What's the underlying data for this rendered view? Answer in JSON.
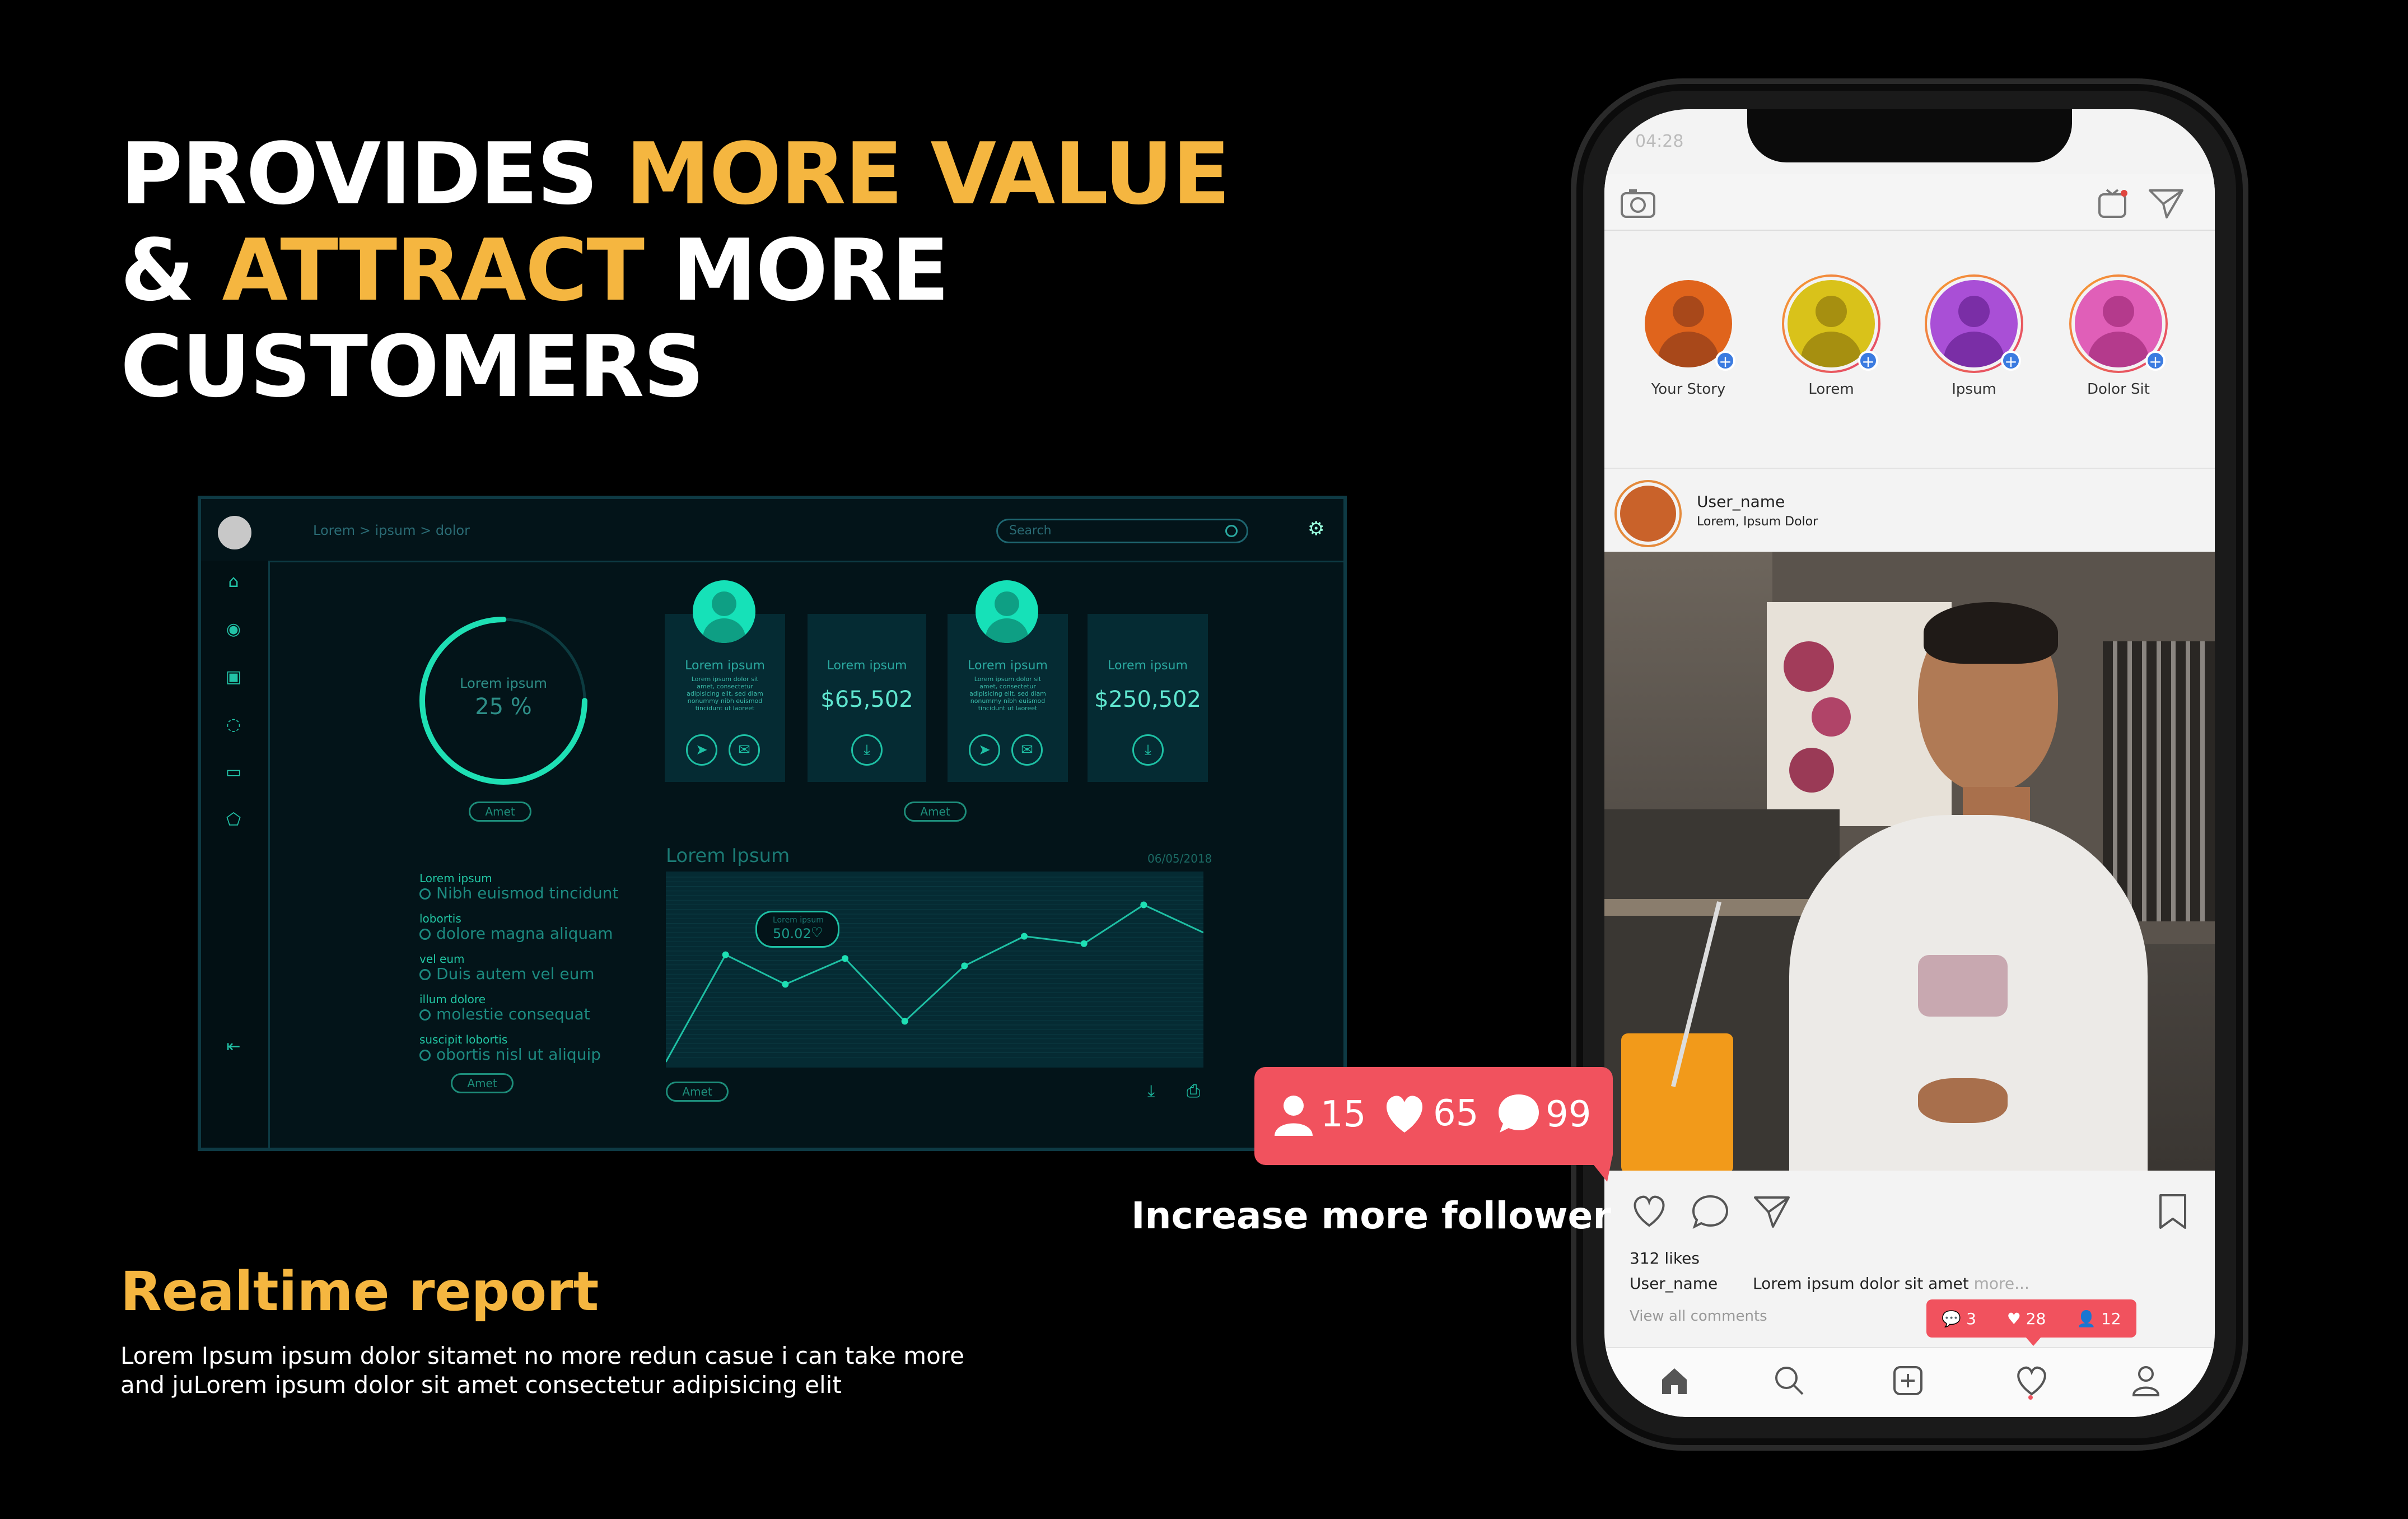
{
  "headline": {
    "line1_a": "PROVIDES ",
    "line1_b": "MORE VALUE",
    "line2_a": "& ",
    "line2_b": "ATTRACT",
    "line2_c": " MORE",
    "line3": "CUSTOMERS"
  },
  "dashboard": {
    "breadcrumb": "Lorem  >  ipsum  >  dolor",
    "search_placeholder": "Search",
    "ring": {
      "label": "Lorem ipsum",
      "value_text": "25 %",
      "percent": 25
    },
    "ring_button": "Amet",
    "cards": [
      {
        "label": "Lorem ipsum",
        "text": "Lorem ipsum dolor sit amet, consectetur adipisicing elit, sed diam nonummy nibh euismod tincidunt ut laoreet"
      },
      {
        "label": "Lorem ipsum",
        "value": "$65,502"
      },
      {
        "label": "Lorem ipsum",
        "text": "Lorem ipsum dolor sit amet, consectetur adipisicing elit, sed diam nonummy nibh euismod tincidunt ut laoreet"
      },
      {
        "label": "Lorem ipsum",
        "value": "$250,502"
      }
    ],
    "cards_button": "Amet",
    "list": [
      {
        "key": "Lorem ipsum",
        "value": "Nibh euismod tincidunt"
      },
      {
        "key": "lobortis",
        "value": "dolore magna aliquam"
      },
      {
        "key": "vel eum",
        "value": "Duis autem vel eum"
      },
      {
        "key": "illum dolore",
        "value": "molestie consequat"
      },
      {
        "key": "suscipit lobortis",
        "value": "obortis nisl ut aliquip"
      }
    ],
    "list_button": "Amet",
    "chart_title": "Lorem Ipsum",
    "chart_date": "06/05/2018",
    "chart_button": "Amet",
    "tooltip_title": "Lorem ipsum",
    "tooltip_value": "50.02"
  },
  "chart_data": {
    "type": "line",
    "title": "Lorem Ipsum",
    "x": [
      0,
      1,
      2,
      3,
      4,
      5,
      6,
      7,
      8,
      9
    ],
    "values": [
      0,
      58,
      42,
      56,
      22,
      52,
      68,
      64,
      85,
      70
    ],
    "ylim": [
      0,
      100
    ],
    "grid": true
  },
  "report": {
    "title": "Realtime report",
    "body_line1": "Lorem Ipsum ipsum dolor sitamet no more redun casue i can take more",
    "body_line2": "and juLorem ipsum dolor sit amet consectetur adipisicing elit"
  },
  "notification": {
    "followers": "15",
    "likes": "65",
    "comments": "99",
    "caption": "Increase more follower"
  },
  "phone": {
    "time": "04:28",
    "stories": [
      {
        "name": "Your Story",
        "color": "#e0641c"
      },
      {
        "name": "Lorem",
        "color": "#d9c21a"
      },
      {
        "name": "Ipsum",
        "color": "#a94fd6"
      },
      {
        "name": "Dolor Sit",
        "color": "#e05fb8"
      }
    ],
    "post": {
      "username": "User_name",
      "subtitle": "Lorem, Ipsum Dolor",
      "likes": "312 likes",
      "caption_user": "User_name",
      "caption_text": "Lorem ipsum dolor sit amet",
      "caption_more": " more...",
      "view_comments": "View all comments"
    },
    "activity": {
      "comments": "3",
      "likes": "28",
      "followers": "12"
    }
  }
}
